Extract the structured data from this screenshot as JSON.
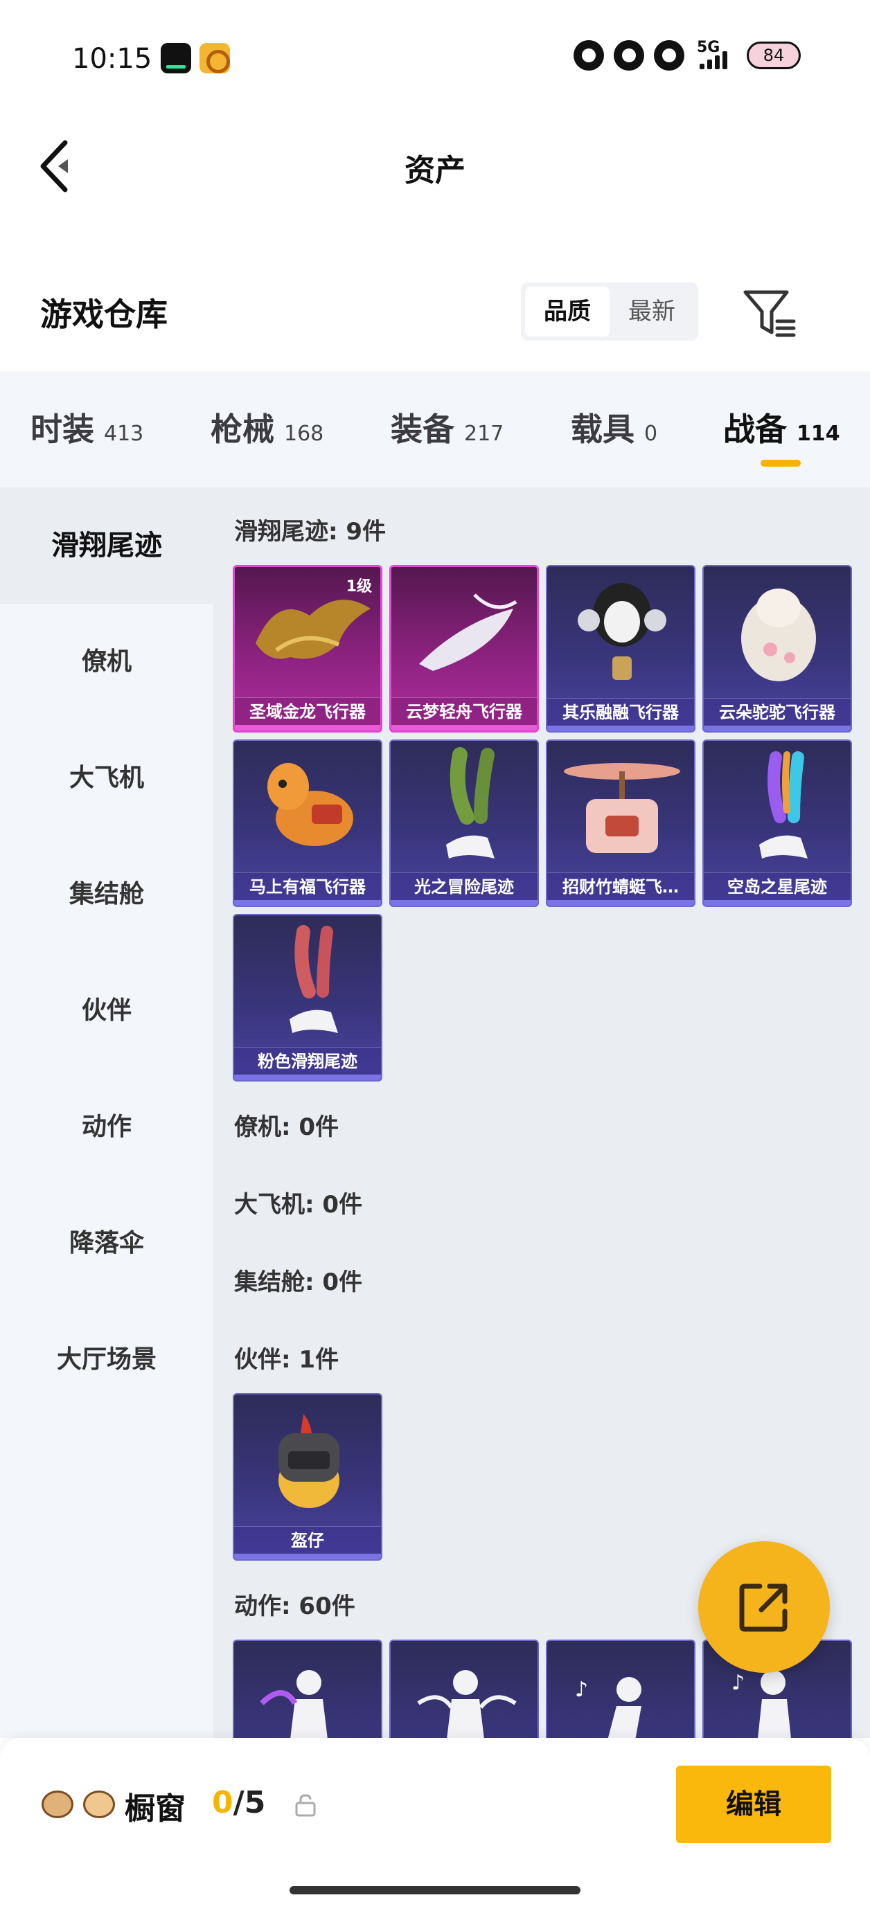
{
  "status_bar": {
    "time": "10:15",
    "network": "5G",
    "battery": "84",
    "icons": [
      "app-icon-1",
      "app-icon-2",
      "flower-icon",
      "bear-icon",
      "paw-icon",
      "signal-icon",
      "battery-icon"
    ]
  },
  "nav": {
    "title": "资产",
    "back_icon": "chevron-left-icon"
  },
  "warehouse": {
    "title": "游戏仓库",
    "sort_options": [
      "品质",
      "最新"
    ],
    "sort_selected": "品质",
    "filter_icon": "filter-icon"
  },
  "categories": [
    {
      "name": "时装",
      "count": "413"
    },
    {
      "name": "枪械",
      "count": "168"
    },
    {
      "name": "装备",
      "count": "217"
    },
    {
      "name": "载具",
      "count": "0"
    },
    {
      "name": "战备",
      "count": "114",
      "active": true
    }
  ],
  "sidebar": {
    "items": [
      "滑翔尾迹",
      "僚机",
      "大飞机",
      "集结舱",
      "伙伴",
      "动作",
      "降落伞",
      "大厅场景"
    ],
    "active": "滑翔尾迹"
  },
  "sections": {
    "trail": {
      "label": "滑翔尾迹: 9件"
    },
    "wingman": {
      "label": "僚机: 0件"
    },
    "plane": {
      "label": "大飞机: 0件"
    },
    "pod": {
      "label": "集结舱: 0件"
    },
    "partner": {
      "label": "伙伴: 1件"
    },
    "emote": {
      "label": "动作: 60件"
    }
  },
  "trail_items": [
    {
      "name": "圣域金龙飞行器",
      "badge": "1级",
      "rarity": "gold"
    },
    {
      "name": "云梦轻舟飞行器",
      "rarity": "gold"
    },
    {
      "name": "其乐融融飞行器",
      "rarity": "purple"
    },
    {
      "name": "云朵驼驼飞行器",
      "rarity": "purple"
    },
    {
      "name": "马上有福飞行器",
      "rarity": "purple"
    },
    {
      "name": "光之冒险尾迹",
      "rarity": "purple"
    },
    {
      "name": "招财竹蜻蜓飞…",
      "rarity": "purple"
    },
    {
      "name": "空岛之星尾迹",
      "rarity": "purple"
    },
    {
      "name": "粉色滑翔尾迹",
      "rarity": "purple"
    }
  ],
  "partner_items": [
    {
      "name": "盔仔",
      "rarity": "purple"
    }
  ],
  "bottom": {
    "showcase_label": "橱窗",
    "showcase_current": "0",
    "showcase_total": "/5",
    "edit_label": "编辑"
  },
  "colors": {
    "accent": "#f6b400",
    "card_purple": "#39357b",
    "card_gold": "#8d2280",
    "panel_bg": "#eaedf2"
  }
}
